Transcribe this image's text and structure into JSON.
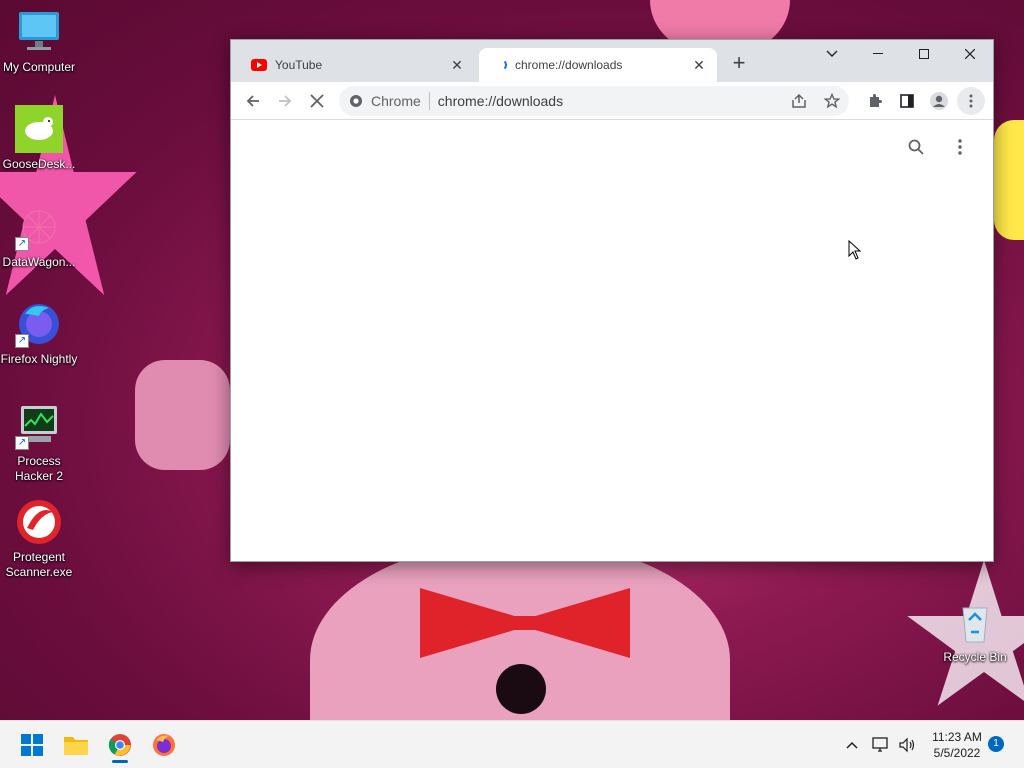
{
  "desktop": {
    "icons": [
      {
        "label": "My Computer"
      },
      {
        "label": "GooseDesk..."
      },
      {
        "label": "DataWagon..."
      },
      {
        "label": "Firefox Nightly"
      },
      {
        "label": "Process Hacker 2"
      },
      {
        "label": "Protegent Scanner.exe"
      },
      {
        "label": "Recycle Bin"
      }
    ]
  },
  "browser": {
    "tabs": [
      {
        "title": "YouTube",
        "favicon": "youtube-icon"
      },
      {
        "title": "chrome://downloads",
        "favicon": "loading-spinner-icon"
      }
    ],
    "omnibox": {
      "site_label": "Chrome",
      "url": "chrome://downloads"
    }
  },
  "taskbar": {
    "apps": [
      "start-icon",
      "file-explorer-icon",
      "chrome-icon",
      "firefox-icon"
    ],
    "clock": {
      "time": "11:23 AM",
      "date": "5/5/2022"
    },
    "notification_count": "1"
  },
  "colors": {
    "accent": "#1a73e8",
    "tabstrip": "#dee1e6",
    "taskbar": "#f3f3f3"
  }
}
